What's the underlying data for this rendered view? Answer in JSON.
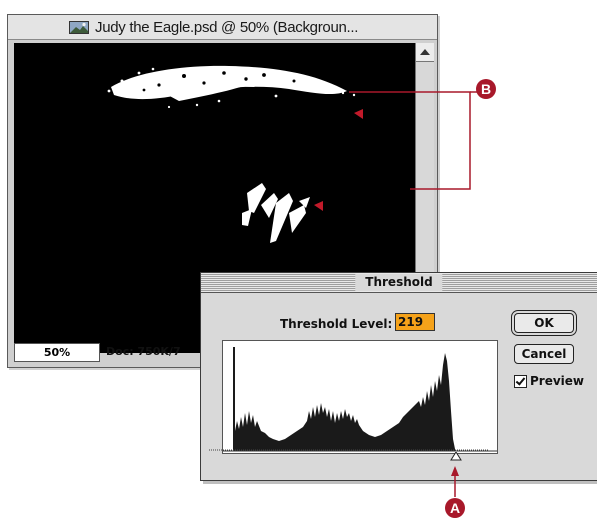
{
  "image_window": {
    "title": "Judy the Eagle.psd @ 50% (Backgroun...",
    "zoom": "50%",
    "doc_size": "Doc: 750K/7"
  },
  "threshold_dialog": {
    "title": "Threshold",
    "level_label": "Threshold Level:",
    "level_value": "219",
    "ok_label": "OK",
    "cancel_label": "Cancel",
    "preview_label": "Preview",
    "preview_checked": true
  },
  "callouts": {
    "a": "A",
    "b": "B"
  },
  "colors": {
    "callout": "#a8182a",
    "input_highlight": "#f5a21a",
    "marker": "#c21a2a"
  }
}
